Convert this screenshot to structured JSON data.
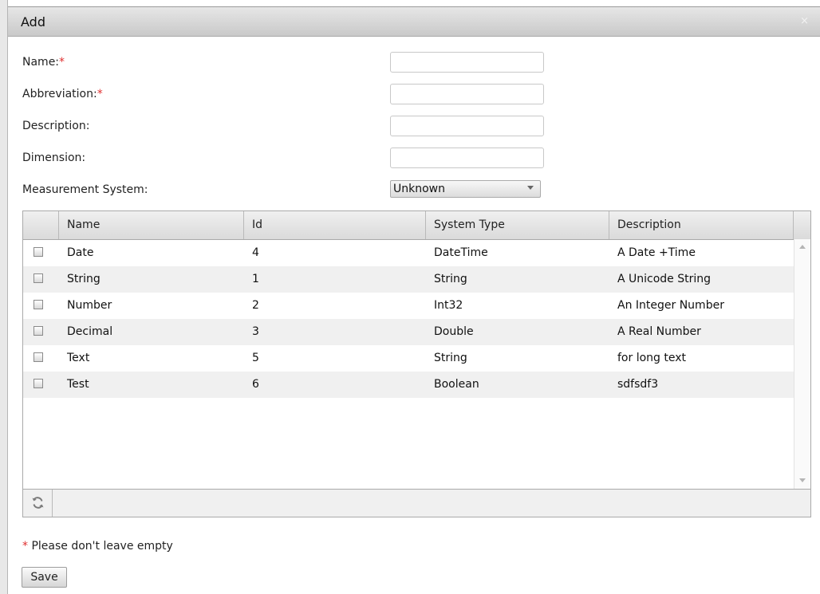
{
  "dialog": {
    "title": "Add",
    "close_glyph": "×"
  },
  "form": {
    "required_mark": "*",
    "name_label": "Name:",
    "abbreviation_label": "Abbreviation:",
    "description_label": "Description:",
    "dimension_label": "Dimension:",
    "measurement_label": "Measurement System:",
    "name_value": "",
    "abbreviation_value": "",
    "description_value": "",
    "dimension_value": "",
    "measurement_value": "Unknown"
  },
  "grid": {
    "columns": [
      "Name",
      "Id",
      "System Type",
      "Description"
    ],
    "rows": [
      {
        "name": "Date",
        "id": "4",
        "type": "DateTime",
        "description": "A Date +Time"
      },
      {
        "name": "String",
        "id": "1",
        "type": "String",
        "description": "A Unicode String"
      },
      {
        "name": "Number",
        "id": "2",
        "type": "Int32",
        "description": "An Integer Number"
      },
      {
        "name": "Decimal",
        "id": "3",
        "type": "Double",
        "description": "A Real Number"
      },
      {
        "name": "Text",
        "id": "5",
        "type": "String",
        "description": "for long text"
      },
      {
        "name": "Test",
        "id": "6",
        "type": "Boolean",
        "description": "sdfsdf3"
      }
    ],
    "refresh_icon": "refresh-icon"
  },
  "footer": {
    "note_mark": "*",
    "note_text": " Please don't leave empty",
    "save_label": "Save"
  }
}
